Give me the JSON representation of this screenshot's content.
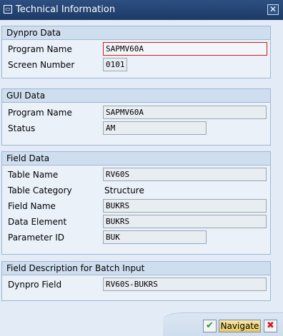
{
  "window": {
    "title": "Technical Information",
    "title_icon": "info-window-icon",
    "close_icon": "close-icon"
  },
  "dynpro_data": {
    "heading": "Dynpro Data",
    "program_name_label": "Program Name",
    "program_name_value": "SAPMV60A",
    "screen_number_label": "Screen Number",
    "screen_number_value": "0101"
  },
  "gui_data": {
    "heading": "GUI Data",
    "program_name_label": "Program Name",
    "program_name_value": "SAPMV60A",
    "status_label": "Status",
    "status_value": "AM"
  },
  "field_data": {
    "heading": "Field Data",
    "table_name_label": "Table Name",
    "table_name_value": "RV60S",
    "table_category_label": "Table Category",
    "table_category_value": "Structure",
    "field_name_label": "Field Name",
    "field_name_value": "BUKRS",
    "data_element_label": "Data Element",
    "data_element_value": "BUKRS",
    "parameter_id_label": "Parameter ID",
    "parameter_id_value": "BUK"
  },
  "batch_input": {
    "heading": "Field Description for Batch Input",
    "dynpro_field_label": "Dynpro Field",
    "dynpro_field_value": "RV60S-BUKRS"
  },
  "footer": {
    "ok_icon": "checkmark-icon",
    "navigate_label": "Navigate",
    "cancel_icon": "cancel-icon"
  },
  "colors": {
    "titlebar": "#1d3a66",
    "group_header": "#cfdeef",
    "focus_border": "#d41c1c",
    "navigate_button": "#e8c95f"
  }
}
